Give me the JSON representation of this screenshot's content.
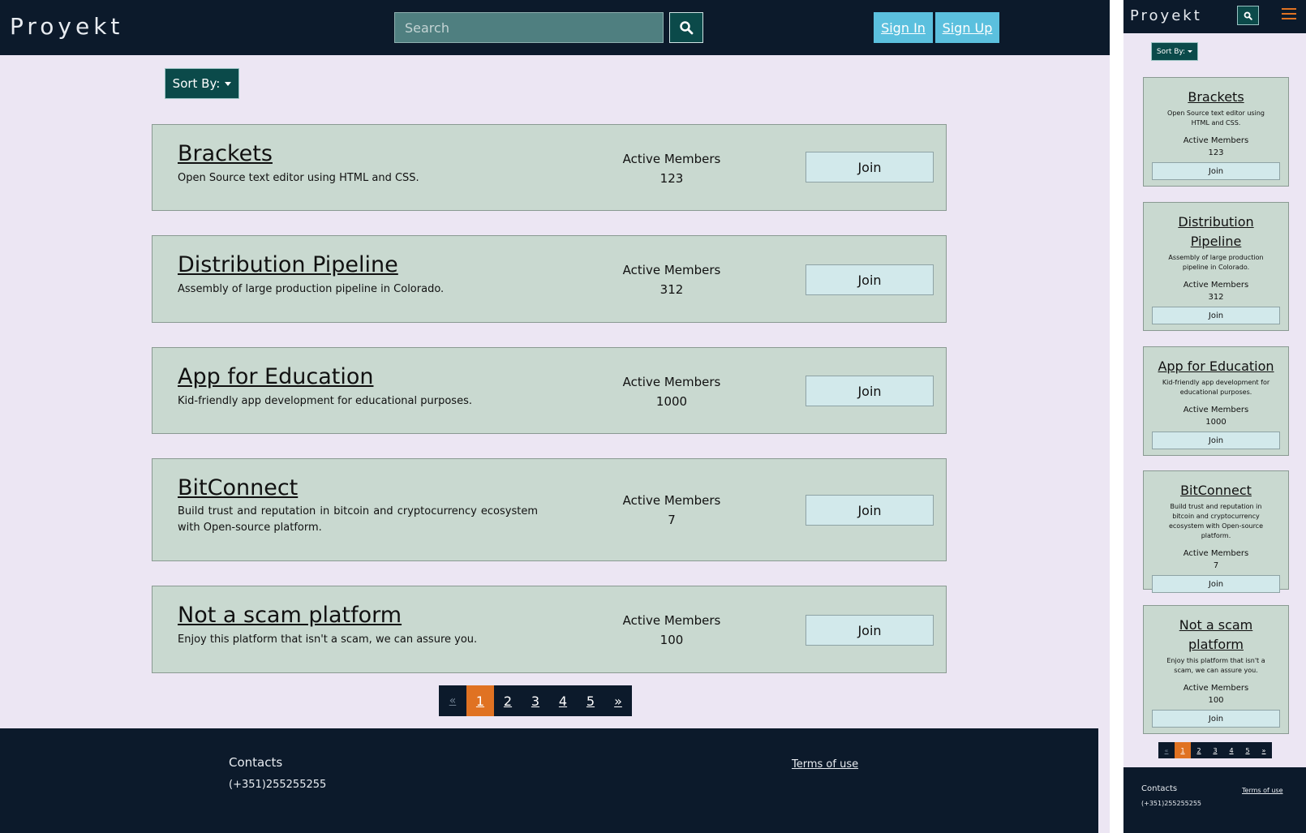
{
  "brand": "Proyekt",
  "search": {
    "placeholder": "Search",
    "icon": "search-icon"
  },
  "auth": {
    "sign_in": "Sign In",
    "sign_up": "Sign Up"
  },
  "sort": {
    "label": "Sort By:"
  },
  "projects": [
    {
      "title": "Brackets",
      "description": "Open Source text editor using HTML and CSS.",
      "members_label": "Active Members",
      "members": "123",
      "join": "Join"
    },
    {
      "title": "Distribution Pipeline",
      "description": "Assembly of large production pipeline in Colorado.",
      "members_label": "Active Members",
      "members": "312",
      "join": "Join"
    },
    {
      "title": "App for Education",
      "description": "Kid-friendly app development for educational purposes.",
      "members_label": "Active Members",
      "members": "1000",
      "join": "Join"
    },
    {
      "title": "BitConnect",
      "description": "Build trust and reputation in bitcoin and cryptocurrency ecosystem with Open-source platform.",
      "members_label": "Active Members",
      "members": "7",
      "join": "Join"
    },
    {
      "title": "Not a scam platform",
      "description": "Enjoy this platform that isn't a scam, we can assure you.",
      "members_label": "Active Members",
      "members": "100",
      "join": "Join"
    }
  ],
  "pagination": {
    "prev": "«",
    "pages": [
      "1",
      "2",
      "3",
      "4",
      "5"
    ],
    "next": "»",
    "current": "1"
  },
  "footer": {
    "contacts_heading": "Contacts",
    "phone": "(+351)255255255",
    "terms": "Terms of use"
  },
  "colors": {
    "navbar": "#0c1a2b",
    "page_bg": "#ece6f3",
    "card_bg": "#c9d9d0",
    "accent": "#e07222",
    "teal": "#0b4a4a",
    "sign_btn": "#5bc0de"
  },
  "mobile": {
    "menu_icon": "hamburger-icon"
  }
}
